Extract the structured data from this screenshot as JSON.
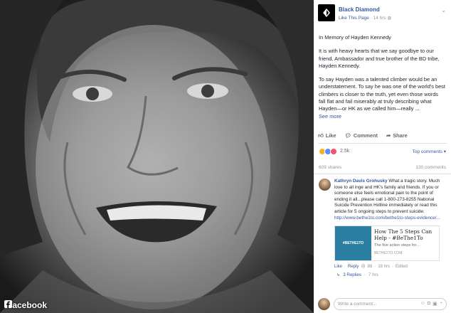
{
  "photo": {
    "watermark": "Facebook"
  },
  "post": {
    "page_name": "Black Diamond",
    "like_this_page": "Like This Page",
    "time": "14 hrs",
    "paragraphs": [
      "In Memory of Hayden Kennedy",
      "It is with heavy hearts that we say goodbye to our friend, Ambassador and true brother of the BD tribe, Hayden Kennedy.",
      "To say Hayden was a talented climber would be an understatement. To say he was one of the world's best climbers is closer to the truth, yet even those words fall flat and fail miserably at truly describing what Hayden—or HK as we called him—really ..."
    ],
    "see_more": "See more"
  },
  "actions": {
    "like": "Like",
    "comment": "Comment",
    "share": "Share"
  },
  "reactions": {
    "count": "2.5k",
    "top_comments": "Top comments"
  },
  "stats": {
    "shares": "609 shares",
    "comments": "130 comments"
  },
  "comment": {
    "author": "Kathryn Davis Grohusky",
    "text": " What a tragic story. Much love to all inge and HK's family and friends. If you or someone else feels emotional pain to the point of ending it all...please call 1-800-273-8255 National Suicide Prevention Hotline immediately or read this article for 5 ongoing steps to prevent suicide:",
    "link": "http://www.bethe1to.com/bethe1to-steps-evidence/...",
    "card": {
      "thumb_text": "#BETHE1TO",
      "title": "How The 5 Steps Can Help - #BeThe1To",
      "desc": "The five action steps for...",
      "domain": "BETHE1TO.COM"
    },
    "meta": {
      "like": "Like",
      "reply": "Reply",
      "reactions": "88",
      "time": "18 hrs",
      "edited": "Edited"
    },
    "replies": {
      "label": "3 Replies",
      "time": "7 hrs"
    }
  },
  "write": {
    "placeholder": "Write a comment..."
  },
  "colors": {
    "link": "#365899",
    "text": "#1d2129",
    "muted": "#90949c"
  }
}
